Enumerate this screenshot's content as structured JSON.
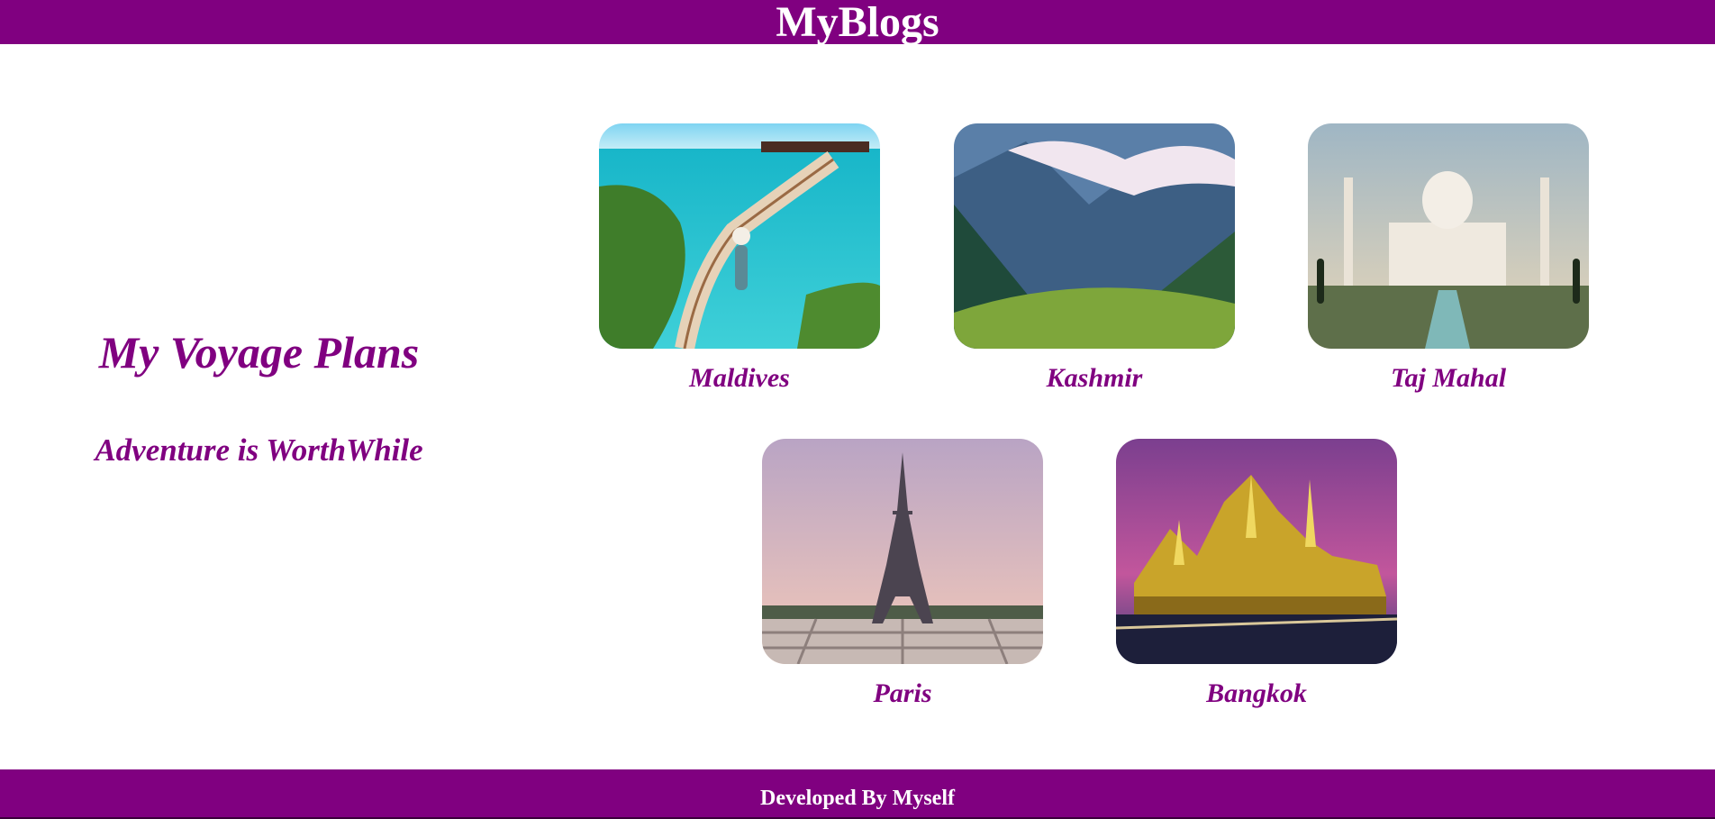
{
  "header": {
    "title": "MyBlogs"
  },
  "intro": {
    "title": "My Voyage Plans",
    "subtitle": "Adventure is WorthWhile"
  },
  "destinations": [
    {
      "name": "Maldives"
    },
    {
      "name": "Kashmir"
    },
    {
      "name": "Taj Mahal"
    },
    {
      "name": "Paris"
    },
    {
      "name": "Bangkok"
    }
  ],
  "footer": {
    "text": "Developed By Myself"
  },
  "colors": {
    "brand": "#800080",
    "background": "#ffffff"
  }
}
